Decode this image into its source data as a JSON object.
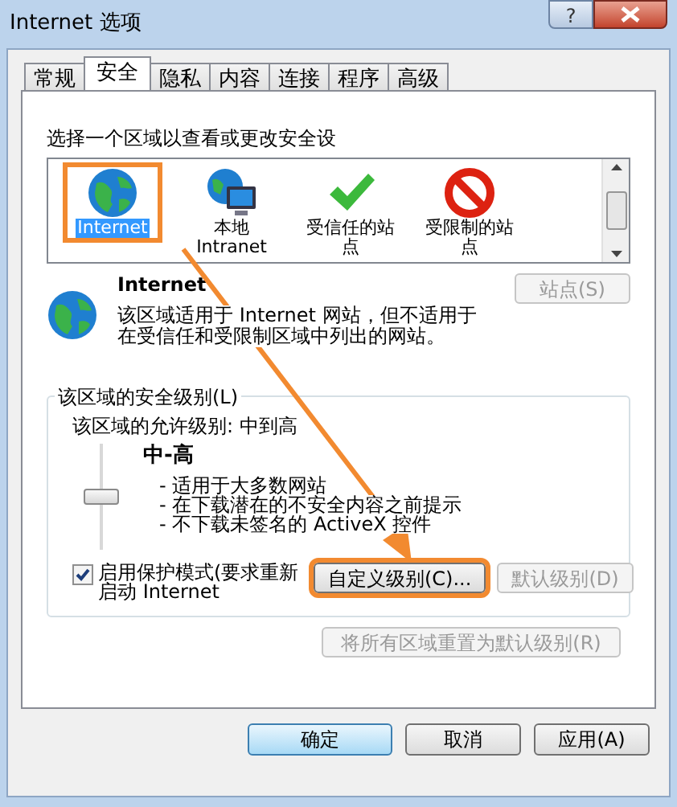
{
  "window": {
    "title": "Internet 选项",
    "help": "?"
  },
  "tabs": [
    {
      "label": "常规",
      "selected": false
    },
    {
      "label": "安全",
      "selected": true
    },
    {
      "label": "隐私",
      "selected": false
    },
    {
      "label": "内容",
      "selected": false
    },
    {
      "label": "连接",
      "selected": false
    },
    {
      "label": "程序",
      "selected": false
    },
    {
      "label": "高级",
      "selected": false
    }
  ],
  "zone_prompt": "选择一个区域以查看或更改安全设",
  "zones": [
    {
      "name": "Internet",
      "kind": "globe",
      "selected": true,
      "highlighted": true
    },
    {
      "name": "本地 Intranet",
      "kind": "intranet",
      "selected": false,
      "highlighted": false
    },
    {
      "name": "受信任的站点",
      "kind": "trusted",
      "selected": false,
      "highlighted": false
    },
    {
      "name": "受限制的站点",
      "kind": "restricted",
      "selected": false,
      "highlighted": false
    }
  ],
  "zone_info": {
    "title": "Internet",
    "description": "该区域适用于 Internet 网站，但不适用于在受信任和受限制区域中列出的网站。",
    "sites_button": {
      "label": "站点(S)",
      "disabled": true
    }
  },
  "security_level": {
    "legend": "该区域的安全级别(L)",
    "allowed": "该区域的允许级别: 中到高",
    "level": 0.5,
    "level_name": "中-高",
    "bullets": [
      "- 适用于大多数网站",
      "- 在下载潜在的不安全内容之前提示",
      "- 不下载未签名的 ActiveX 控件"
    ]
  },
  "protected_mode": {
    "label": "启用保护模式(要求重新启动 Internet",
    "checked": true
  },
  "level_buttons": [
    {
      "label": "自定义级别(C)...",
      "disabled": false,
      "highlighted": true
    },
    {
      "label": "默认级别(D)",
      "disabled": true,
      "highlighted": false
    }
  ],
  "reset_button": {
    "label": "将所有区域重置为默认级别(R)",
    "disabled": true
  },
  "footer_buttons": [
    {
      "label": "确定",
      "default": true
    },
    {
      "label": "取消",
      "default": false
    },
    {
      "label": "应用(A)",
      "default": false
    }
  ]
}
